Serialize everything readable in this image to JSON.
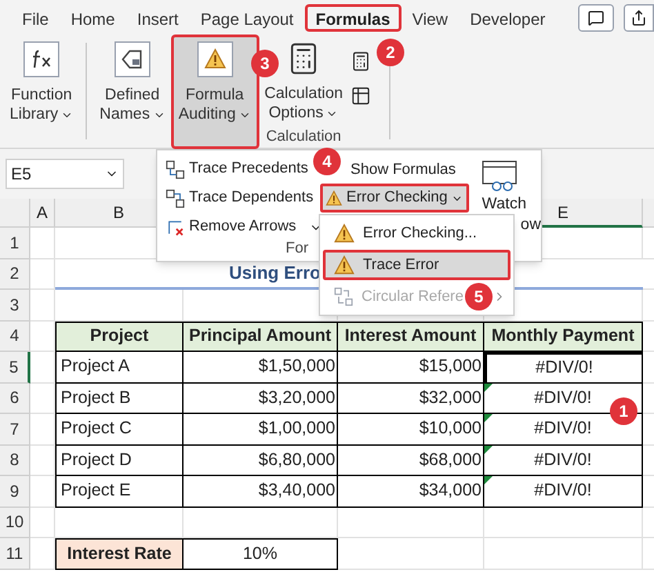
{
  "tabs": [
    {
      "label": "File",
      "selected": false,
      "outlined": false
    },
    {
      "label": "Home",
      "selected": false,
      "outlined": false
    },
    {
      "label": "Insert",
      "selected": false,
      "outlined": false
    },
    {
      "label": "Page Layout",
      "selected": false,
      "outlined": false
    },
    {
      "label": "Formulas",
      "selected": true,
      "outlined": true
    },
    {
      "label": "View",
      "selected": false,
      "outlined": false
    },
    {
      "label": "Developer",
      "selected": false,
      "outlined": false
    }
  ],
  "ribbon": {
    "buttons": [
      {
        "kind": "function",
        "lines": [
          "Function",
          "Library"
        ],
        "pressed": false,
        "outlined": false
      },
      {
        "kind": "names",
        "lines": [
          "Defined",
          "Names"
        ],
        "pressed": false,
        "outlined": false
      },
      {
        "kind": "auditing",
        "lines": [
          "Formula",
          "Auditing"
        ],
        "pressed": true,
        "outlined": true
      },
      {
        "kind": "calculation",
        "lines": [
          "Calculation",
          "Options"
        ],
        "pressed": false,
        "outlined": false
      }
    ],
    "group_label": "Calculation"
  },
  "name_box": {
    "value": "E5"
  },
  "column_headers": [
    "A",
    "B",
    "E"
  ],
  "row_headers": [
    "1",
    "2",
    "3",
    "4",
    "5",
    "6",
    "7",
    "8",
    "9",
    "10",
    "11"
  ],
  "sheet": {
    "title": "Using Erro",
    "columns": [
      "Project",
      "Principal Amount",
      "Interest Amount",
      "Monthly Payment"
    ],
    "rows": [
      {
        "cells": [
          "Project A",
          "$1,50,000",
          "$15,000",
          "#DIV/0!"
        ],
        "error_indicator": false,
        "outlined": true
      },
      {
        "cells": [
          "Project B",
          "$3,20,000",
          "$32,000",
          "#DIV/0!"
        ],
        "error_indicator": true,
        "outlined": false
      },
      {
        "cells": [
          "Project C",
          "$1,00,000",
          "$10,000",
          "#DIV/0!"
        ],
        "error_indicator": true,
        "outlined": false
      },
      {
        "cells": [
          "Project D",
          "$6,80,000",
          "$68,000",
          "#DIV/0!"
        ],
        "error_indicator": true,
        "outlined": false
      },
      {
        "cells": [
          "Project E",
          "$3,40,000",
          "$34,000",
          "#DIV/0!"
        ],
        "error_indicator": true,
        "outlined": false
      }
    ],
    "rate": {
      "label": "Interest Rate",
      "value": "10%"
    }
  },
  "auditing_menu": {
    "items": [
      {
        "label": "Trace Precedents",
        "kind": "precedents"
      },
      {
        "label": "Trace Dependents",
        "kind": "dependents"
      },
      {
        "label": "Remove Arrows",
        "kind": "remove"
      }
    ],
    "show_formulas": "Show Formulas",
    "error_checking": {
      "label": "Error Checking",
      "pressed": true,
      "outlined": true
    },
    "watch": [
      "Watch",
      "ow"
    ],
    "group_label": "For"
  },
  "error_menu": {
    "items": [
      {
        "label": "Error Checking...",
        "kind": "check",
        "selected": false,
        "outlined": false,
        "disabled": false,
        "submenu": false
      },
      {
        "label": "Trace Error",
        "kind": "trace",
        "selected": true,
        "outlined": true,
        "disabled": false,
        "submenu": false
      },
      {
        "label": "Circular Refere",
        "kind": "circular",
        "selected": false,
        "outlined": false,
        "disabled": true,
        "submenu": true
      }
    ]
  },
  "badges": [
    "1",
    "2",
    "3",
    "4",
    "5"
  ]
}
